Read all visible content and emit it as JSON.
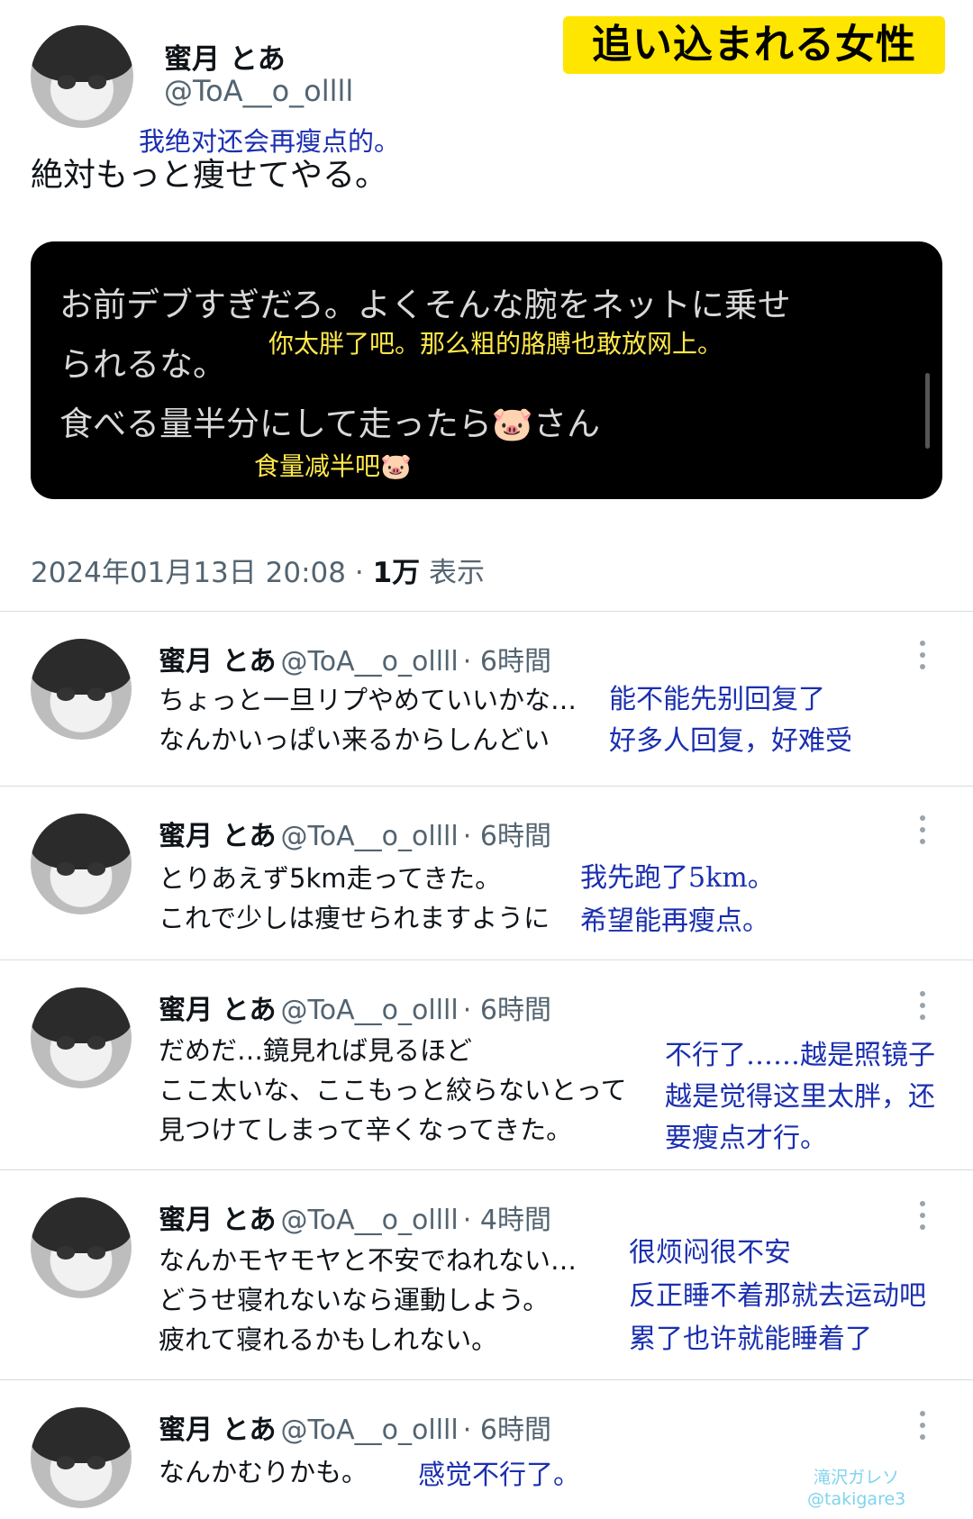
{
  "header_badge": "追い込まれる女性",
  "main_tweet": {
    "name": "蜜月 とあ",
    "handle": "@ToA__o_ollll",
    "translation": "我绝对还会再瘦点的。",
    "text": "絶対もっと痩せてやる。",
    "quoted_reply": {
      "line1": "お前デブすぎだろ。よくそんな腕をネットに乗せ",
      "line2": "られるな。",
      "line3": "食べる量半分にして走ったら🐷さん",
      "translation1": "你太胖了吧。那么粗的胳膊也敢放网上。",
      "translation2": "食量减半吧🐷"
    },
    "meta": {
      "date": "2024年01月13日 20:08",
      "separator": "·",
      "views": "1万",
      "views_label": "表示"
    }
  },
  "replies": [
    {
      "name": "蜜月 とあ",
      "handle": "@ToA__o_ollll",
      "time": "· 6時間",
      "lines": [
        "ちょっと一旦リプやめていいかな…",
        "なんかいっぱい来るからしんどい"
      ],
      "translations": [
        "能不能先别回复了",
        "好多人回复，好难受"
      ]
    },
    {
      "name": "蜜月 とあ",
      "handle": "@ToA__o_ollll",
      "time": "· 6時間",
      "lines": [
        "とりあえず5km走ってきた。",
        "これで少しは痩せられますように"
      ],
      "translations": [
        "我先跑了5km。",
        "希望能再瘦点。"
      ]
    },
    {
      "name": "蜜月 とあ",
      "handle": "@ToA__o_ollll",
      "time": "· 6時間",
      "lines": [
        "だめだ…鏡見れば見るほど",
        "ここ太いな、ここもっと絞らないとって",
        "見つけてしまって辛くなってきた。"
      ],
      "translations": [
        "不行了……越是照镜子",
        "越是觉得这里太胖，还",
        "要瘦点才行。"
      ]
    },
    {
      "name": "蜜月 とあ",
      "handle": "@ToA__o_ollll",
      "time": "· 4時間",
      "lines": [
        "なんかモヤモヤと不安でねれない…",
        "どうせ寝れないなら運動しよう。",
        "疲れて寝れるかもしれない。"
      ],
      "translations": [
        "很烦闷很不安",
        "反正睡不着那就去运动吧",
        "累了也许就能睡着了"
      ]
    },
    {
      "name": "蜜月 とあ",
      "handle": "@ToA__o_ollll",
      "time": "· 6時間",
      "lines": [
        "なんかむりかも。"
      ],
      "translations": [
        "感觉不行了。"
      ]
    }
  ],
  "watermark": {
    "line1": "滝沢ガレソ",
    "line2": "@takigare3"
  },
  "colors": {
    "badge_bg": "#ffe600",
    "translation_blue": "#1a2fb0",
    "translation_yellow": "#ffe94a",
    "quote_bg": "#000000",
    "watermark": "#7fd3ee"
  }
}
